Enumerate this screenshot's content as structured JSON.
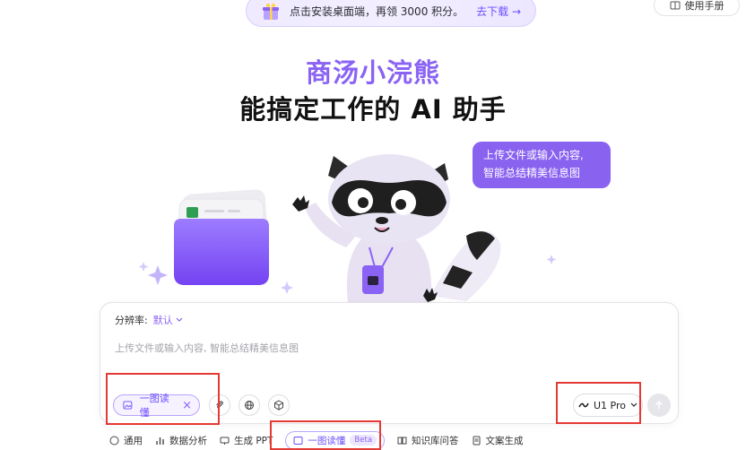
{
  "promo": {
    "text": "点击安装桌面端，再领 3000 积分。",
    "link": "去下载 →"
  },
  "header": {
    "manual_label": "使用手册"
  },
  "hero": {
    "brand": "商汤小浣熊",
    "tagline": "能搞定工作的 AI 助手"
  },
  "bubble": {
    "line1": "上传文件或输入内容,",
    "line2": "智能总结精美信息图"
  },
  "composer": {
    "resolution_label": "分辨率:",
    "resolution_value": "默认",
    "placeholder": "上传文件或输入内容, 智能总结精美信息图",
    "active_chip": "一图读懂",
    "model": "U1 Pro"
  },
  "tools": [
    {
      "label": "通用"
    },
    {
      "label": "数据分析"
    },
    {
      "label": "生成 PPT"
    },
    {
      "label": "一图读懂",
      "badge": "Beta"
    },
    {
      "label": "知识库问答"
    },
    {
      "label": "文案生成"
    }
  ],
  "colors": {
    "accent": "#8a63f4",
    "annotation": "#e53935"
  }
}
